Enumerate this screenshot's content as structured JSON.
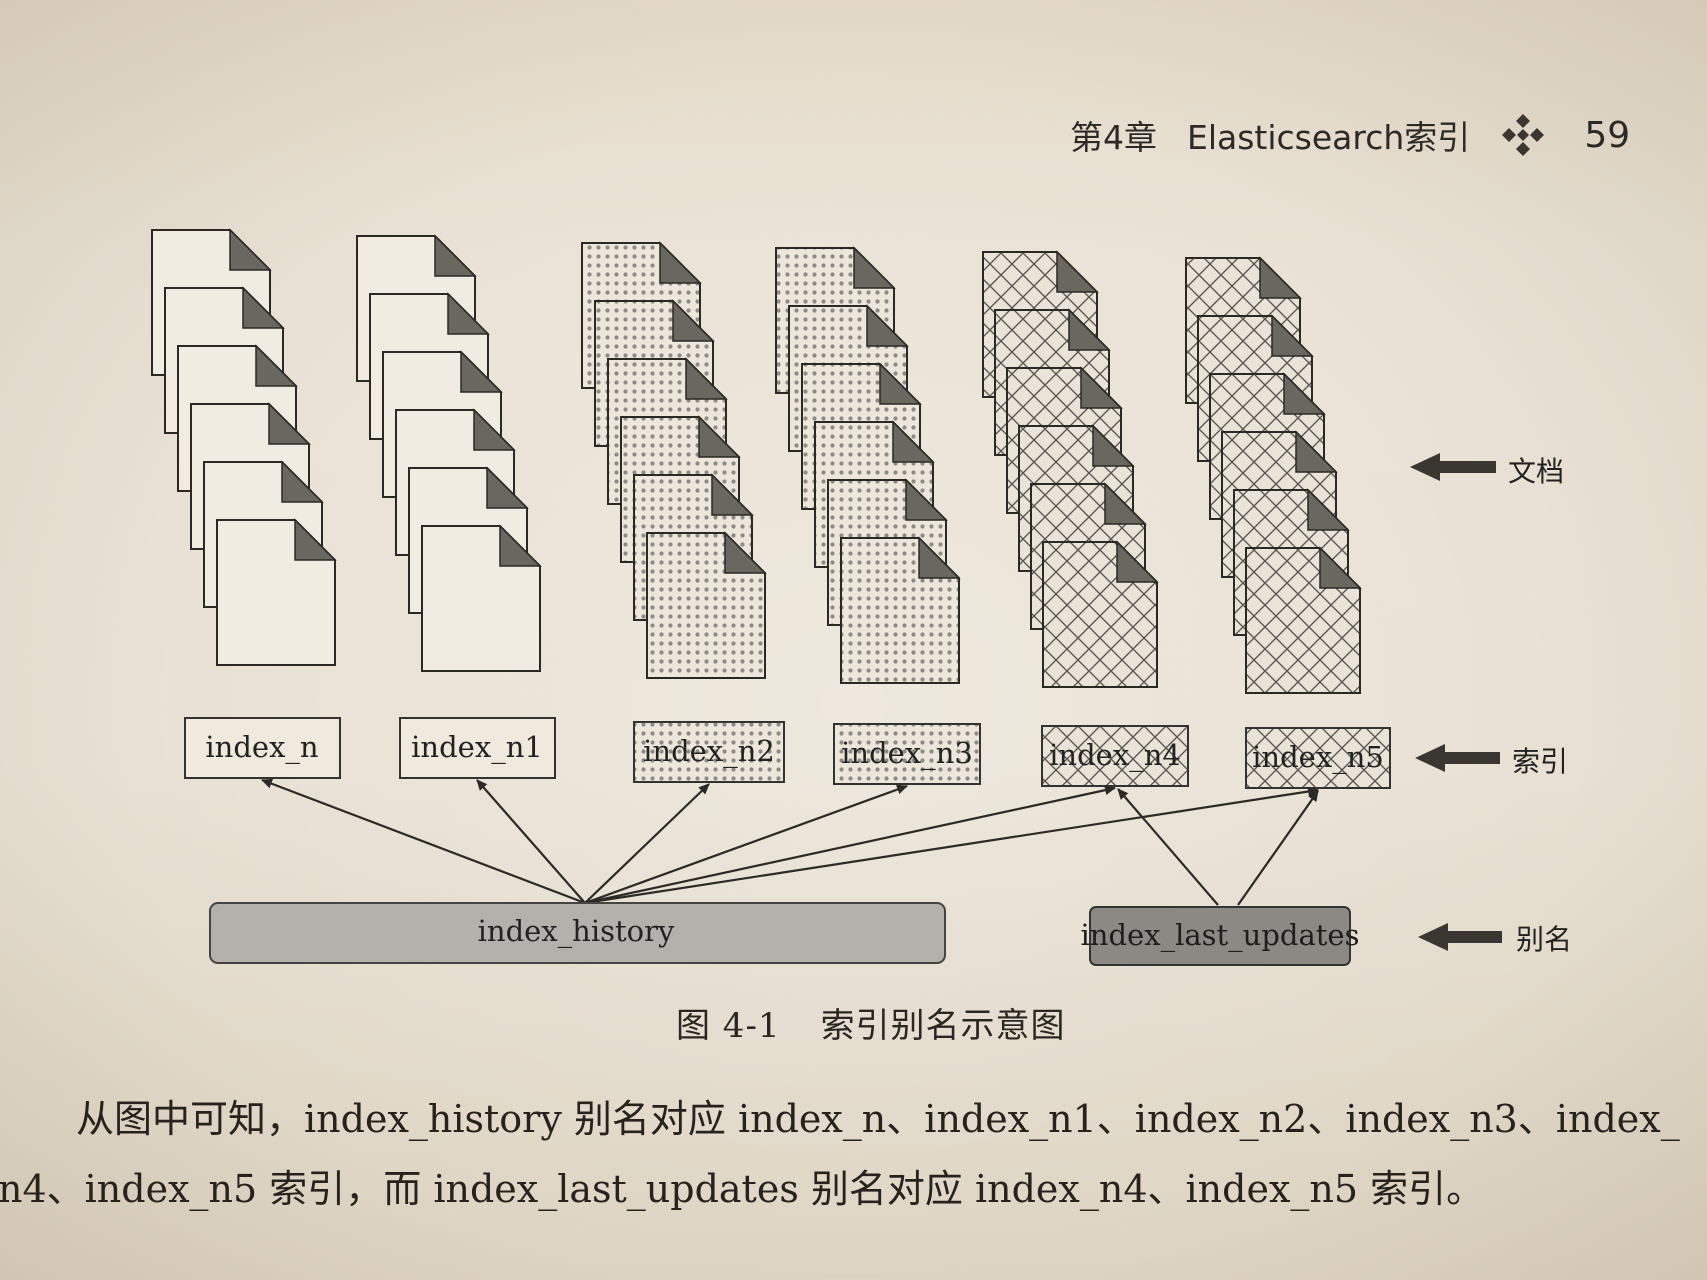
{
  "header": {
    "chapter": "第4章",
    "title": "Elasticsearch索引",
    "page_number": "59"
  },
  "diagram": {
    "indices": [
      "index_n",
      "index_n1",
      "index_n2",
      "index_n3",
      "index_n4",
      "index_n5"
    ],
    "aliases": [
      "index_history",
      "index_last_updates"
    ],
    "legend": {
      "documents": "文档",
      "index": "索引",
      "alias": "别名"
    }
  },
  "caption": {
    "number": "图 4-1",
    "text": "索引别名示意图"
  },
  "paragraph": {
    "line1": "从图中可知，index_history 别名对应 index_n、index_n1、index_n2、index_n3、index_",
    "line2": "n4、index_n5 索引，而 index_last_updates 别名对应 index_n4、index_n5 索引。"
  }
}
